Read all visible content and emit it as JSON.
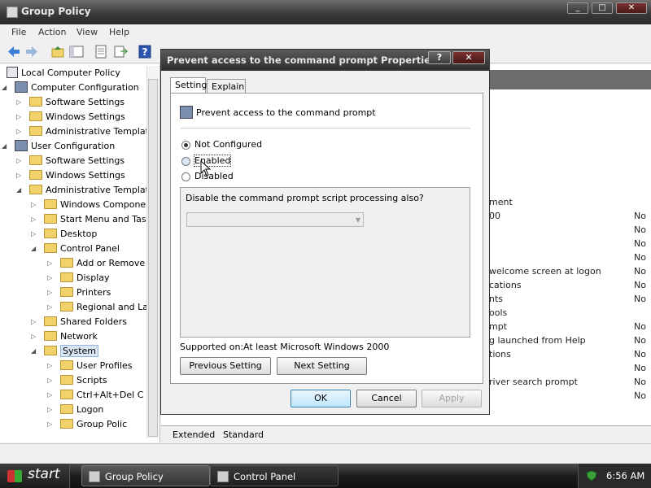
{
  "window": {
    "title": "Group Policy",
    "controls": [
      "_",
      "□",
      "✕"
    ]
  },
  "menu": [
    "File",
    "Action",
    "View",
    "Help"
  ],
  "tree": [
    {
      "label": "Local Computer Policy",
      "indent": 0,
      "kind": "root"
    },
    {
      "label": "Computer Configuration",
      "indent": 1,
      "kind": "comp"
    },
    {
      "label": "Software Settings",
      "indent": 2,
      "kind": "folder"
    },
    {
      "label": "Windows Settings",
      "indent": 2,
      "kind": "folder"
    },
    {
      "label": "Administrative Templat",
      "indent": 2,
      "kind": "folder"
    },
    {
      "label": "User Configuration",
      "indent": 1,
      "kind": "comp"
    },
    {
      "label": "Software Settings",
      "indent": 2,
      "kind": "folder"
    },
    {
      "label": "Windows Settings",
      "indent": 2,
      "kind": "folder"
    },
    {
      "label": "Administrative Templat",
      "indent": 2,
      "kind": "folder"
    },
    {
      "label": "Windows Compone",
      "indent": 3,
      "kind": "folder"
    },
    {
      "label": "Start Menu and Tas",
      "indent": 3,
      "kind": "folder"
    },
    {
      "label": "Desktop",
      "indent": 3,
      "kind": "folder"
    },
    {
      "label": "Control Panel",
      "indent": 3,
      "kind": "folder"
    },
    {
      "label": "Add or Remove",
      "indent": 4,
      "kind": "folder"
    },
    {
      "label": "Display",
      "indent": 4,
      "kind": "folder"
    },
    {
      "label": "Printers",
      "indent": 4,
      "kind": "folder"
    },
    {
      "label": "Regional and La",
      "indent": 4,
      "kind": "folder"
    },
    {
      "label": "Shared Folders",
      "indent": 3,
      "kind": "folder"
    },
    {
      "label": "Network",
      "indent": 3,
      "kind": "folder"
    },
    {
      "label": "System",
      "indent": 3,
      "kind": "folder",
      "selected": true
    },
    {
      "label": "User Profiles",
      "indent": 4,
      "kind": "folder"
    },
    {
      "label": "Scripts",
      "indent": 4,
      "kind": "folder"
    },
    {
      "label": "Ctrl+Alt+Del C",
      "indent": 4,
      "kind": "folder"
    },
    {
      "label": "Logon",
      "indent": 4,
      "kind": "folder"
    },
    {
      "label": "Group Polic",
      "indent": 4,
      "kind": "folder"
    }
  ],
  "right_list": [
    {
      "setting": "ment",
      "state": ""
    },
    {
      "setting": "00",
      "state": "No"
    },
    {
      "setting": "",
      "state": "No"
    },
    {
      "setting": "",
      "state": "No"
    },
    {
      "setting": "",
      "state": "No"
    },
    {
      "setting": "welcome screen at logon",
      "state": "No"
    },
    {
      "setting": "cations",
      "state": "No"
    },
    {
      "setting": "nts",
      "state": "No"
    },
    {
      "setting": "ools",
      "state": ""
    },
    {
      "setting": "mpt",
      "state": "No"
    },
    {
      "setting": "g launched from Help",
      "state": "No"
    },
    {
      "setting": "tions",
      "state": "No"
    },
    {
      "setting": "",
      "state": "No"
    },
    {
      "setting": "river search prompt",
      "state": "No"
    },
    {
      "setting": "",
      "state": "No"
    }
  ],
  "bottom_tabs": [
    "Extended",
    "Standard"
  ],
  "dialog": {
    "title": "Prevent access to the command prompt Properties",
    "help_btn": "?",
    "close_btn": "✕",
    "tabs": [
      "Setting",
      "Explain"
    ],
    "policy_name": "Prevent access to the command prompt",
    "options": [
      {
        "label": "Not Configured",
        "checked": true
      },
      {
        "label": "Enabled",
        "checked": false
      },
      {
        "label": "Disabled",
        "checked": false
      }
    ],
    "sub_question": "Disable the command prompt script processing also?",
    "combo_value": "",
    "supported_label": "Supported on:",
    "supported_value": "At least Microsoft Windows 2000",
    "prev_btn": "Previous Setting",
    "next_btn": "Next Setting",
    "ok": "OK",
    "cancel": "Cancel",
    "apply": "Apply"
  },
  "taskbar": {
    "start": "start",
    "tasks": [
      {
        "label": "Group Policy",
        "active": true
      },
      {
        "label": "Control Panel",
        "active": false
      }
    ],
    "clock": "6:56 AM"
  }
}
